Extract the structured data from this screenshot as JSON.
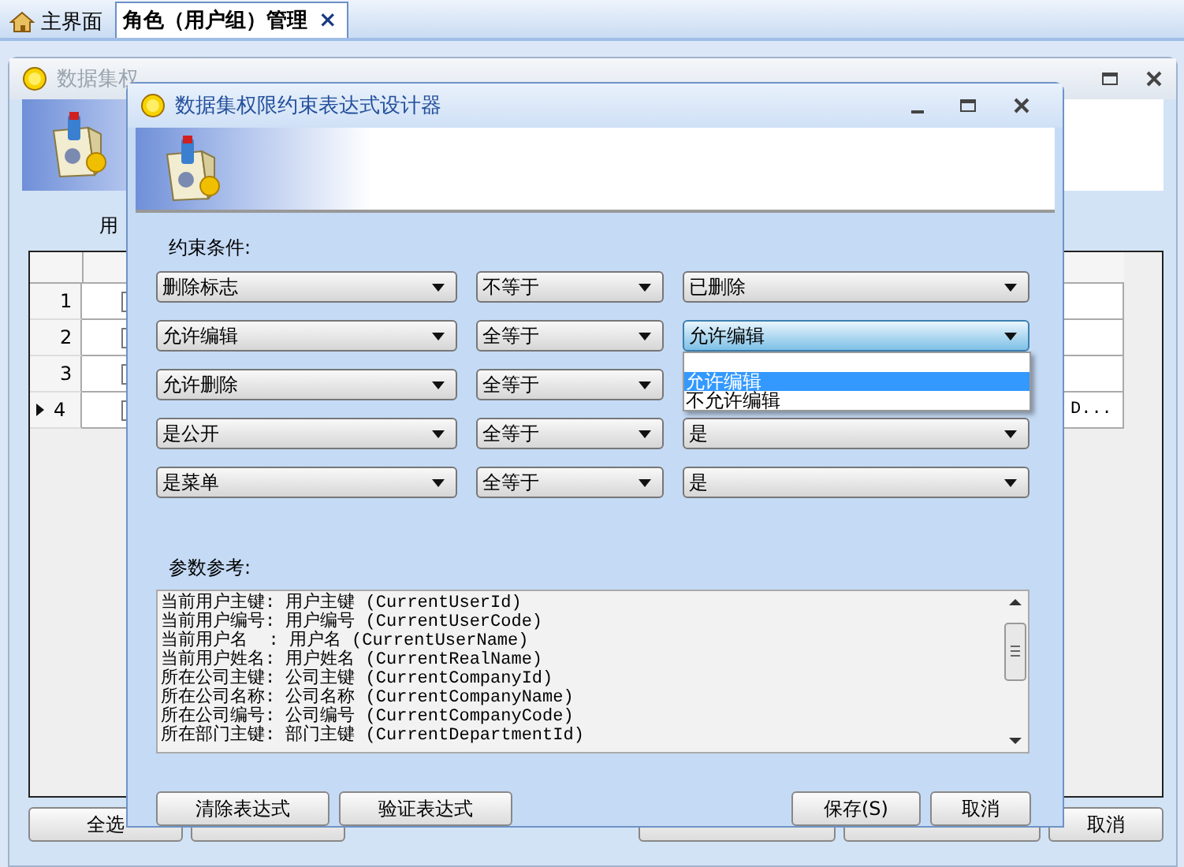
{
  "tabs": [
    {
      "label": "主界面",
      "kind": "home",
      "selected": false
    },
    {
      "label": "角色（用户组）管理",
      "kind": "plain",
      "selected": true,
      "close": "×"
    }
  ],
  "background_window": {
    "title": "数据集权",
    "label": "用",
    "grid": {
      "rows": [
        {
          "number": "1",
          "current": false
        },
        {
          "number": "2",
          "current": false
        },
        {
          "number": "3",
          "current": false
        },
        {
          "number": "4",
          "current": true,
          "column_3": "D..."
        }
      ]
    },
    "left_buttons": [
      "全选"
    ],
    "right_buttons": [
      "取消"
    ]
  },
  "dialog": {
    "title": "数据集权限约束表达式设计器",
    "conditions_label": "约束条件:",
    "conditions": [
      {
        "field": "删除标志",
        "operator": "不等于",
        "value": "已删除"
      },
      {
        "field": "允许编辑",
        "operator": "全等于",
        "value": "允许编辑",
        "focused": true
      },
      {
        "field": "允许删除",
        "operator": "全等于"
      },
      {
        "field": "是公开",
        "operator": "全等于",
        "value": "是"
      },
      {
        "field": "是菜单",
        "operator": "全等于",
        "value": "是"
      }
    ],
    "dropdown": {
      "options": [
        {
          "label": "允许编辑",
          "selected": true
        },
        {
          "label": "不允许编辑",
          "selected": false
        }
      ]
    },
    "reference_label": "参数参考:",
    "reference_lines": [
      "当前用户主键: 用户主键 (CurrentUserId)",
      "当前用户编号: 用户编号 (CurrentUserCode)",
      "当前用户名  : 用户名 (CurrentUserName)",
      "当前用户姓名: 用户姓名 (CurrentRealName)",
      "所在公司主键: 公司主键 (CurrentCompanyId)",
      "所在公司名称: 公司名称 (CurrentCompanyName)",
      "所在公司编号: 公司编号 (CurrentCompanyCode)",
      "所在部门主键: 部门主键 (CurrentDepartmentId)"
    ],
    "left_buttons": [
      "清除表达式",
      "验证表达式"
    ],
    "right_buttons": [
      "保存(S)",
      "取消"
    ]
  }
}
